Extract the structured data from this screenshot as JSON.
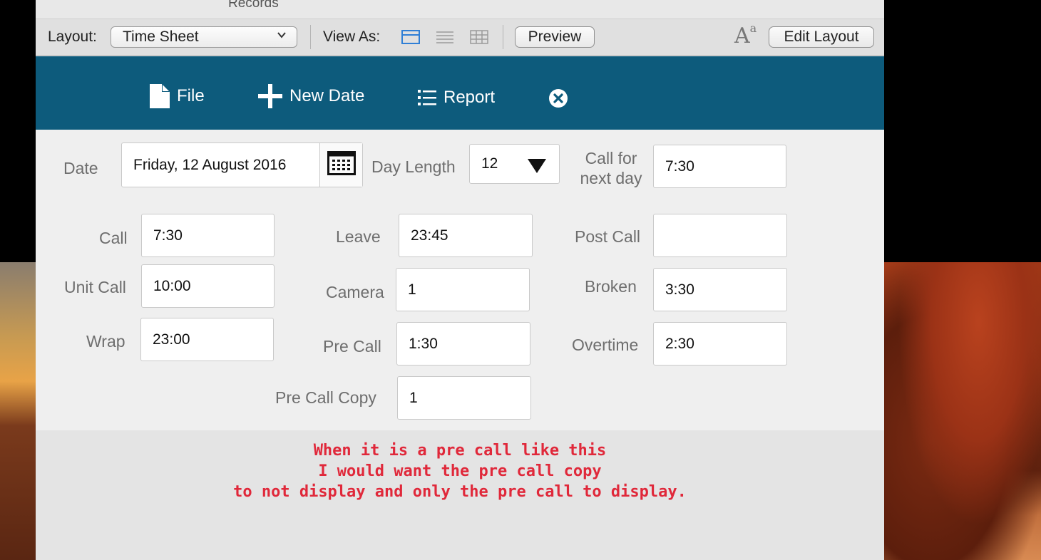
{
  "header": {
    "records_label": "Records",
    "layout_label": "Layout:",
    "layout_value": "Time Sheet",
    "view_as_label": "View As:",
    "preview_label": "Preview",
    "font_glyph": "A",
    "font_glyph_sup": "a",
    "edit_layout_label": "Edit Layout"
  },
  "toolbar": {
    "file_label": "File",
    "new_date_label": "New Date",
    "report_label": "Report"
  },
  "form": {
    "date_label": "Date",
    "date_value": "Friday, 12 August 2016",
    "day_length_label": "Day Length",
    "day_length_value": "12",
    "call_next_day_label_1": "Call for",
    "call_next_day_label_2": "next day",
    "call_next_day_value": "7:30",
    "call_label": "Call",
    "call_value": "7:30",
    "unit_call_label": "Unit Call",
    "unit_call_value": "10:00",
    "wrap_label": "Wrap",
    "wrap_value": "23:00",
    "leave_label": "Leave",
    "leave_value": "23:45",
    "camera_label": "Camera",
    "camera_value": "1",
    "pre_call_label": "Pre Call",
    "pre_call_value": "1:30",
    "pre_call_copy_label": "Pre Call Copy",
    "pre_call_copy_value": "1",
    "post_call_label": "Post Call",
    "post_call_value": "",
    "broken_label": "Broken",
    "broken_value": "3:30",
    "overtime_label": "Overtime",
    "overtime_value": "2:30"
  },
  "note": {
    "line1": "When it is a pre call like this",
    "line2": "I would want the pre call copy",
    "line3": "to not display and only the pre call to display.",
    "color": "#e0283a"
  },
  "colors": {
    "toolbar_bg": "#0d5b7c",
    "view_active": "#2f7fd6"
  }
}
